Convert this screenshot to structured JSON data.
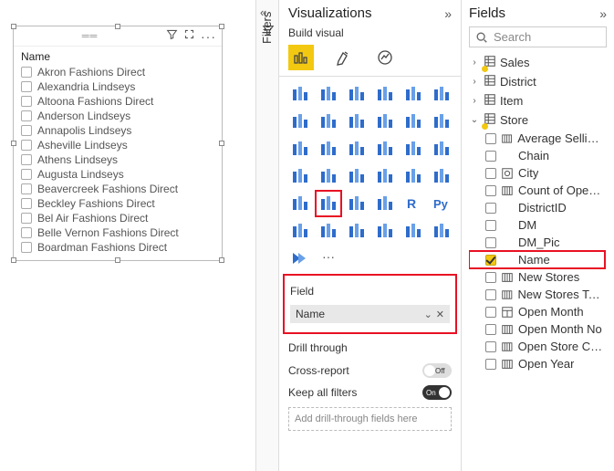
{
  "canvas": {
    "slicer": {
      "title": "Name",
      "items": [
        "Akron Fashions Direct",
        "Alexandria Lindseys",
        "Altoona Fashions Direct",
        "Anderson Lindseys",
        "Annapolis Lindseys",
        "Asheville Lindseys",
        "Athens Lindseys",
        "Augusta Lindseys",
        "Beavercreek Fashions Direct",
        "Beckley Fashions Direct",
        "Bel Air Fashions Direct",
        "Belle Vernon Fashions Direct",
        "Boardman Fashions Direct"
      ],
      "toolbar": {
        "filter_icon": "filter-icon",
        "focus_icon": "focus-mode-icon",
        "more": "···"
      }
    }
  },
  "filters_tab": {
    "label": "Filters",
    "collapse_icon": "«"
  },
  "viz_pane": {
    "title": "Visualizations",
    "expand_icon": "»",
    "build_label": "Build visual",
    "tabs": [
      "build-visual-tab",
      "format-visual-tab",
      "analytics-tab"
    ],
    "viz_icons": [
      "stacked-bar",
      "stacked-column",
      "clustered-bar",
      "clustered-column",
      "100-stacked-bar",
      "100-stacked-column",
      "line",
      "area",
      "stacked-area",
      "line-stacked-column",
      "line-clustered-column",
      "ribbon",
      "waterfall",
      "funnel",
      "scatter",
      "pie",
      "donut",
      "treemap",
      "map",
      "filled-map",
      "azure-map",
      "gauge",
      "card",
      "multi-row-card",
      "kpi",
      "slicer",
      "table",
      "matrix",
      "r-visual",
      "python-visual",
      "key-influencers",
      "decomposition-tree",
      "qna",
      "narrative",
      "paginated",
      "power-apps",
      "power-automate",
      "more-visuals"
    ],
    "selected_viz": "slicer",
    "field_section_label": "Field",
    "field_chip": {
      "name": "Name",
      "dropdown_icon": "⌄",
      "remove_icon": "✕"
    },
    "drill": {
      "heading": "Drill through",
      "cross_report_label": "Cross-report",
      "cross_report_on": false,
      "keep_filters_label": "Keep all filters",
      "keep_filters_on": true,
      "on_text": "On",
      "off_text": "Off",
      "drop_placeholder": "Add drill-through fields here"
    }
  },
  "fields_pane": {
    "title": "Fields",
    "expand_icon": "»",
    "search_placeholder": "Search",
    "tables": [
      {
        "name": "Sales",
        "expanded": false,
        "has_measures": true
      },
      {
        "name": "District",
        "expanded": false
      },
      {
        "name": "Item",
        "expanded": false
      },
      {
        "name": "Store",
        "expanded": true,
        "has_measures": true,
        "fields": [
          {
            "name": "Average Selling...",
            "icon": "measure",
            "checked": false
          },
          {
            "name": "Chain",
            "icon": "none",
            "checked": false
          },
          {
            "name": "City",
            "icon": "geo",
            "checked": false
          },
          {
            "name": "Count of Open...",
            "icon": "measure",
            "checked": false
          },
          {
            "name": "DistrictID",
            "icon": "none",
            "checked": false
          },
          {
            "name": "DM",
            "icon": "none",
            "checked": false
          },
          {
            "name": "DM_Pic",
            "icon": "none",
            "checked": false
          },
          {
            "name": "Name",
            "icon": "none",
            "checked": true,
            "highlight": true
          },
          {
            "name": "New Stores",
            "icon": "measure",
            "checked": false
          },
          {
            "name": "New Stores Tar...",
            "icon": "measure",
            "checked": false
          },
          {
            "name": "Open Month",
            "icon": "hierarchy",
            "checked": false
          },
          {
            "name": "Open Month No",
            "icon": "measure",
            "checked": false
          },
          {
            "name": "Open Store Co...",
            "icon": "measure",
            "checked": false
          },
          {
            "name": "Open Year",
            "icon": "measure",
            "checked": false
          }
        ]
      }
    ]
  },
  "colors": {
    "accent": "#F2C811",
    "call_out": "#E81123"
  }
}
